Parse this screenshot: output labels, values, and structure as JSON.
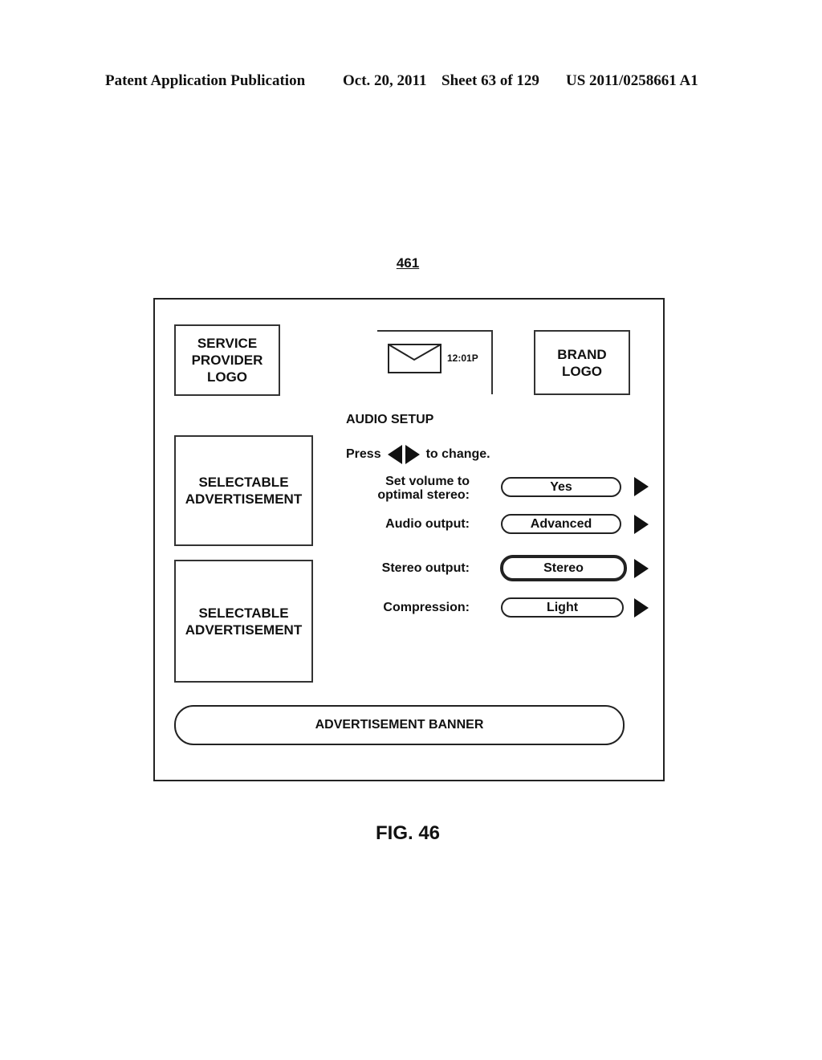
{
  "header": {
    "publication": "Patent Application Publication",
    "date": "Oct. 20, 2011",
    "sheet": "Sheet 63 of 129",
    "number": "US 2011/0258661 A1"
  },
  "figure_ref": "461",
  "screen": {
    "service_provider_logo": "SERVICE PROVIDER LOGO",
    "brand_logo": "BRAND LOGO",
    "clock": "12:01P",
    "mail_icon": "envelope-icon",
    "ads": [
      "SELECTABLE ADVERTISEMENT",
      "SELECTABLE ADVERTISEMENT"
    ],
    "title": "AUDIO SETUP",
    "instruction_prefix": "Press",
    "instruction_suffix": "to change.",
    "settings": [
      {
        "label_line1": "Set volume to",
        "label_line2": "optimal stereo:",
        "value": "Yes",
        "selected": false
      },
      {
        "label_line1": "Audio output:",
        "label_line2": "",
        "value": "Advanced",
        "selected": false
      },
      {
        "label_line1": "Stereo output:",
        "label_line2": "",
        "value": "Stereo",
        "selected": true
      },
      {
        "label_line1": "Compression:",
        "label_line2": "",
        "value": "Light",
        "selected": false
      }
    ],
    "banner": "ADVERTISEMENT BANNER"
  },
  "caption": "FIG. 46"
}
